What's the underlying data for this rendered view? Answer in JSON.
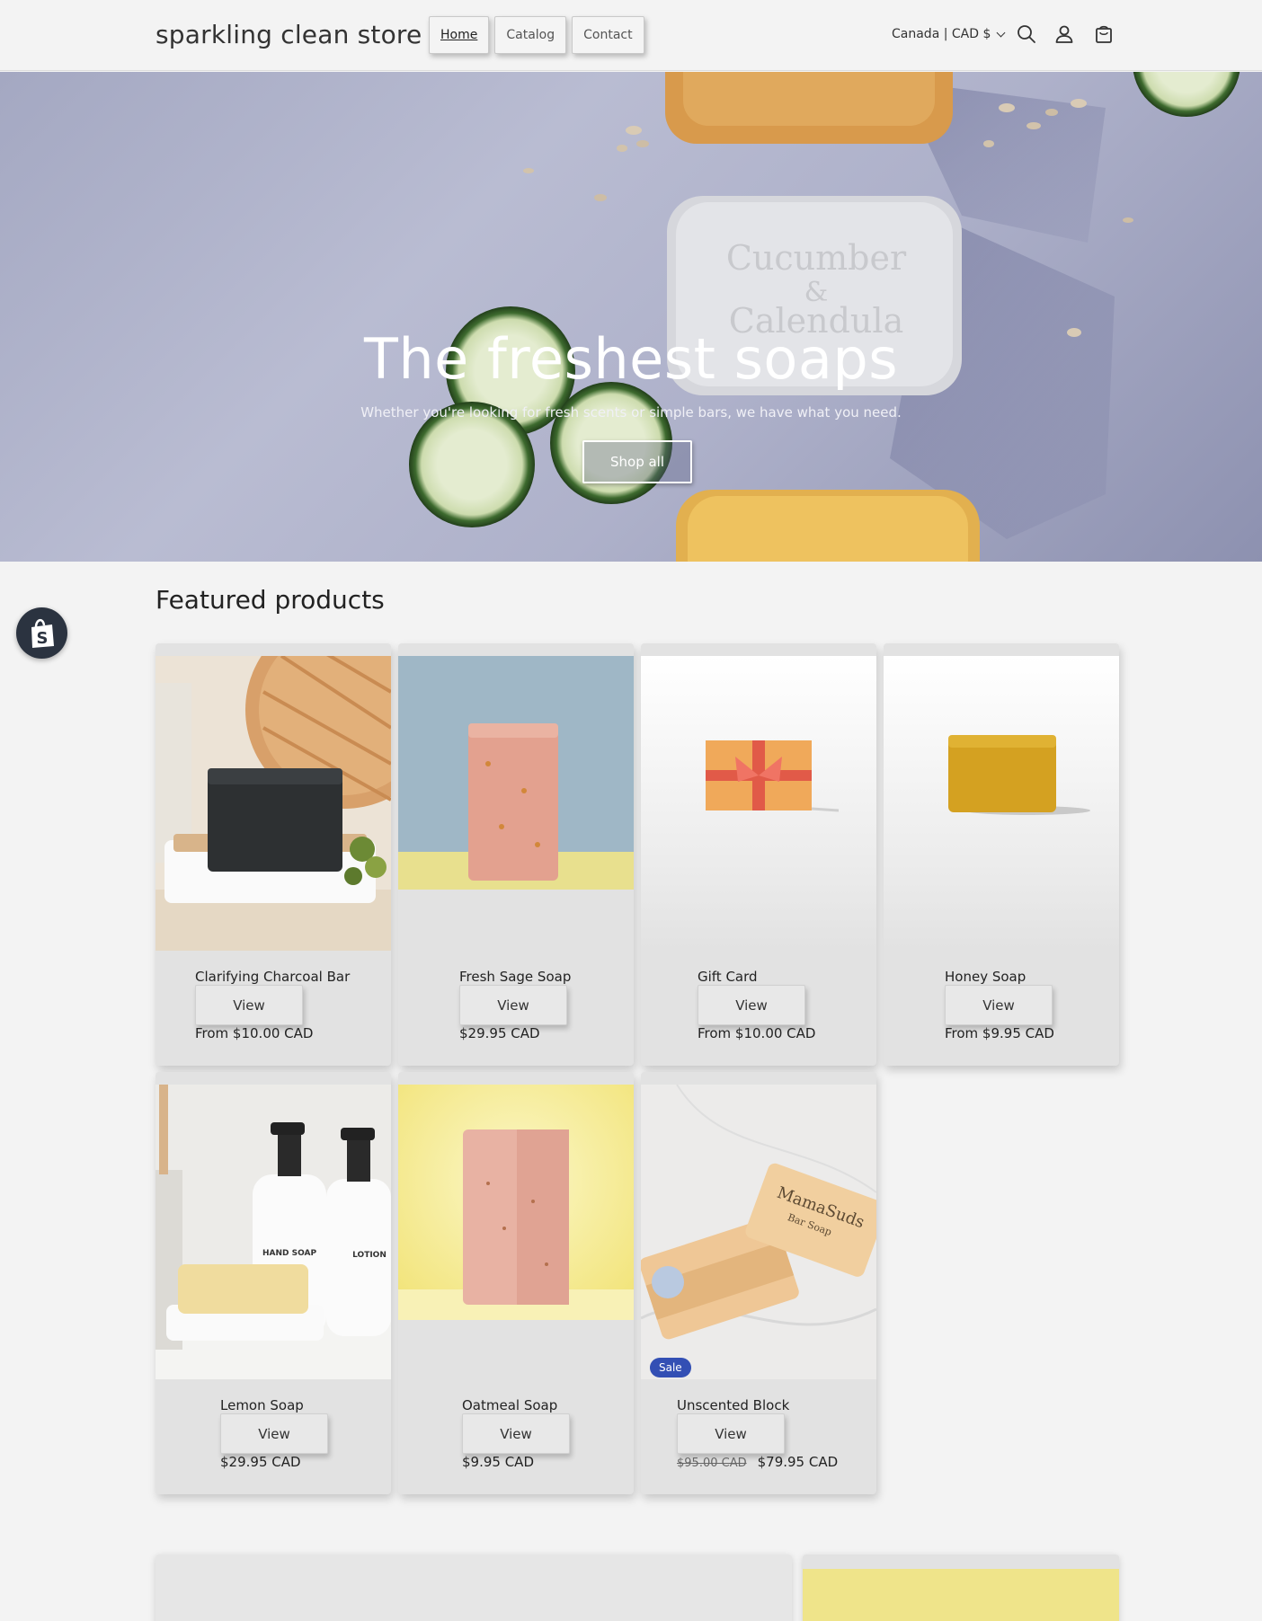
{
  "header": {
    "store_name": "sparkling clean store",
    "nav": [
      {
        "label": "Home"
      },
      {
        "label": "Catalog"
      },
      {
        "label": "Contact"
      }
    ],
    "country_selector": "Canada | CAD $",
    "icons": [
      "search-icon",
      "account-icon",
      "cart-icon"
    ]
  },
  "hero": {
    "title": "The freshest soaps",
    "subtitle": "Whether you're looking for fresh scents or simple bars, we have what you need.",
    "button_label": "Shop all"
  },
  "featured": {
    "title": "Featured products",
    "products": [
      {
        "name": "Clarifying Charcoal Bar",
        "view_label": "View",
        "price": "From $10.00 CAD"
      },
      {
        "name": "Fresh Sage Soap",
        "view_label": "View",
        "price": "$29.95 CAD"
      },
      {
        "name": "Gift Card",
        "view_label": "View",
        "price": "From $10.00 CAD"
      },
      {
        "name": "Honey Soap",
        "view_label": "View",
        "price": "From $9.95 CAD"
      },
      {
        "name": "Lemon Soap",
        "view_label": "View",
        "price": "$29.95 CAD"
      },
      {
        "name": "Oatmeal Soap",
        "view_label": "View",
        "price": "$9.95 CAD"
      },
      {
        "name": "Unscented Block",
        "view_label": "View",
        "price_old": "$95.00 CAD",
        "price": "$79.95 CAD",
        "badge": "Sale"
      }
    ]
  },
  "colors": {
    "background": "#f3f3f3",
    "card": "#e2e2e2",
    "sale_badge": "#334fb4",
    "shopify_badge": "#2b3340"
  }
}
